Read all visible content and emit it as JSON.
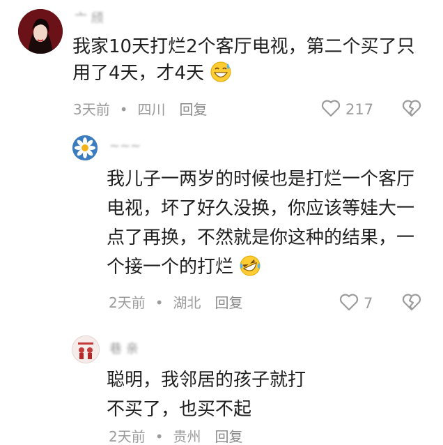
{
  "comments": [
    {
      "username": "亠 颀",
      "text_lines": [
        "我家10天打烂2个客厅电视，第二个买了只",
        "用了4天，才4天"
      ],
      "emoji": "grinning-sweat-emoji",
      "time": "3天前",
      "location": "四川",
      "reply_label": "回复",
      "likes": "217"
    },
    {
      "username": "~~~",
      "text_lines": [
        "我儿子一两岁的时候也是打烂一个客厅",
        "电视，坏了好久没换，你应该等娃大一",
        "点了再换，不然就是你这种的结果，一",
        "个接一个的打烂"
      ],
      "emoji": "rolling-laugh-emoji",
      "time": "2天前",
      "location": "湖北",
      "reply_label": "回复",
      "likes": "7"
    },
    {
      "username": "巷 亲",
      "text_lines": [
        "聪明，我邻居的孩子就打",
        "不买了，也买不起"
      ],
      "time": "2天前",
      "location": "贵州",
      "reply_label": "回复"
    }
  ],
  "separator": "•",
  "colors": {
    "meta": "#9b9b9b",
    "text": "#1f1f1f"
  }
}
